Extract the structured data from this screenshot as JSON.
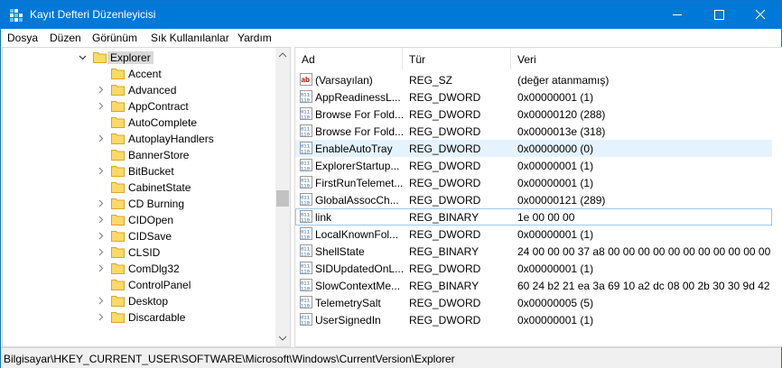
{
  "window": {
    "title": "Kayıt Defteri Düzenleyicisi"
  },
  "menu": {
    "items": [
      "Dosya",
      "Düzen",
      "Görünüm",
      "Sık Kullanılanlar",
      "Yardım"
    ]
  },
  "tree": {
    "selected": "Explorer",
    "items": [
      {
        "label": "Explorer",
        "expanded": true,
        "selected": true
      },
      {
        "label": "Accent",
        "has_children": false
      },
      {
        "label": "Advanced",
        "has_children": true
      },
      {
        "label": "AppContract",
        "has_children": true
      },
      {
        "label": "AutoComplete",
        "has_children": false
      },
      {
        "label": "AutoplayHandlers",
        "has_children": true
      },
      {
        "label": "BannerStore",
        "has_children": false
      },
      {
        "label": "BitBucket",
        "has_children": true
      },
      {
        "label": "CabinetState",
        "has_children": false
      },
      {
        "label": "CD Burning",
        "has_children": true
      },
      {
        "label": "CIDOpen",
        "has_children": true
      },
      {
        "label": "CIDSave",
        "has_children": true
      },
      {
        "label": "CLSID",
        "has_children": true
      },
      {
        "label": "ComDlg32",
        "has_children": true
      },
      {
        "label": "ControlPanel",
        "has_children": false
      },
      {
        "label": "Desktop",
        "has_children": true
      },
      {
        "label": "Discardable",
        "has_children": true
      }
    ]
  },
  "columns": {
    "name": "Ad",
    "type": "Tür",
    "data": "Veri"
  },
  "values": [
    {
      "icon": "string-value-icon",
      "name": "(Varsayılan)",
      "type": "REG_SZ",
      "data": "(değer atanmamış)"
    },
    {
      "icon": "binary-value-icon",
      "name": "AppReadinessL...",
      "type": "REG_DWORD",
      "data": "0x00000001 (1)"
    },
    {
      "icon": "binary-value-icon",
      "name": "Browse For Fold...",
      "type": "REG_DWORD",
      "data": "0x00000120 (288)"
    },
    {
      "icon": "binary-value-icon",
      "name": "Browse For Fold...",
      "type": "REG_DWORD",
      "data": "0x0000013e (318)"
    },
    {
      "icon": "binary-value-icon",
      "name": "EnableAutoTray",
      "type": "REG_DWORD",
      "data": "0x00000000 (0)",
      "hovered": true
    },
    {
      "icon": "binary-value-icon",
      "name": "ExplorerStartup...",
      "type": "REG_DWORD",
      "data": "0x00000001 (1)"
    },
    {
      "icon": "binary-value-icon",
      "name": "FirstRunTelemet...",
      "type": "REG_DWORD",
      "data": "0x00000001 (1)"
    },
    {
      "icon": "binary-value-icon",
      "name": "GlobalAssocCh...",
      "type": "REG_DWORD",
      "data": "0x00000121 (289)"
    },
    {
      "icon": "binary-value-icon",
      "name": "link",
      "type": "REG_BINARY",
      "data": "1e 00 00 00",
      "focused": true
    },
    {
      "icon": "binary-value-icon",
      "name": "LocalKnownFol...",
      "type": "REG_DWORD",
      "data": "0x00000001 (1)"
    },
    {
      "icon": "binary-value-icon",
      "name": "ShellState",
      "type": "REG_BINARY",
      "data": "24 00 00 00 37 a8 00 00 00 00 00 00 00 00 00 00 00 00 00..."
    },
    {
      "icon": "binary-value-icon",
      "name": "SIDUpdatedOnL...",
      "type": "REG_DWORD",
      "data": "0x00000001 (1)"
    },
    {
      "icon": "binary-value-icon",
      "name": "SlowContextMe...",
      "type": "REG_BINARY",
      "data": "60 24 b2 21 ea 3a 69 10 a2 dc 08 00 2b 30 30 9d 42 0..."
    },
    {
      "icon": "binary-value-icon",
      "name": "TelemetrySalt",
      "type": "REG_DWORD",
      "data": "0x00000005 (5)"
    },
    {
      "icon": "binary-value-icon",
      "name": "UserSignedIn",
      "type": "REG_DWORD",
      "data": "0x00000001 (1)"
    }
  ],
  "status": {
    "path": "Bilgisayar\\HKEY_CURRENT_USER\\SOFTWARE\\Microsoft\\Windows\\CurrentVersion\\Explorer"
  },
  "colors": {
    "titlebar": "#0078d7",
    "hover": "#e5f3ff",
    "focus_border": "#99c9ef",
    "folder": "#ffd966"
  }
}
